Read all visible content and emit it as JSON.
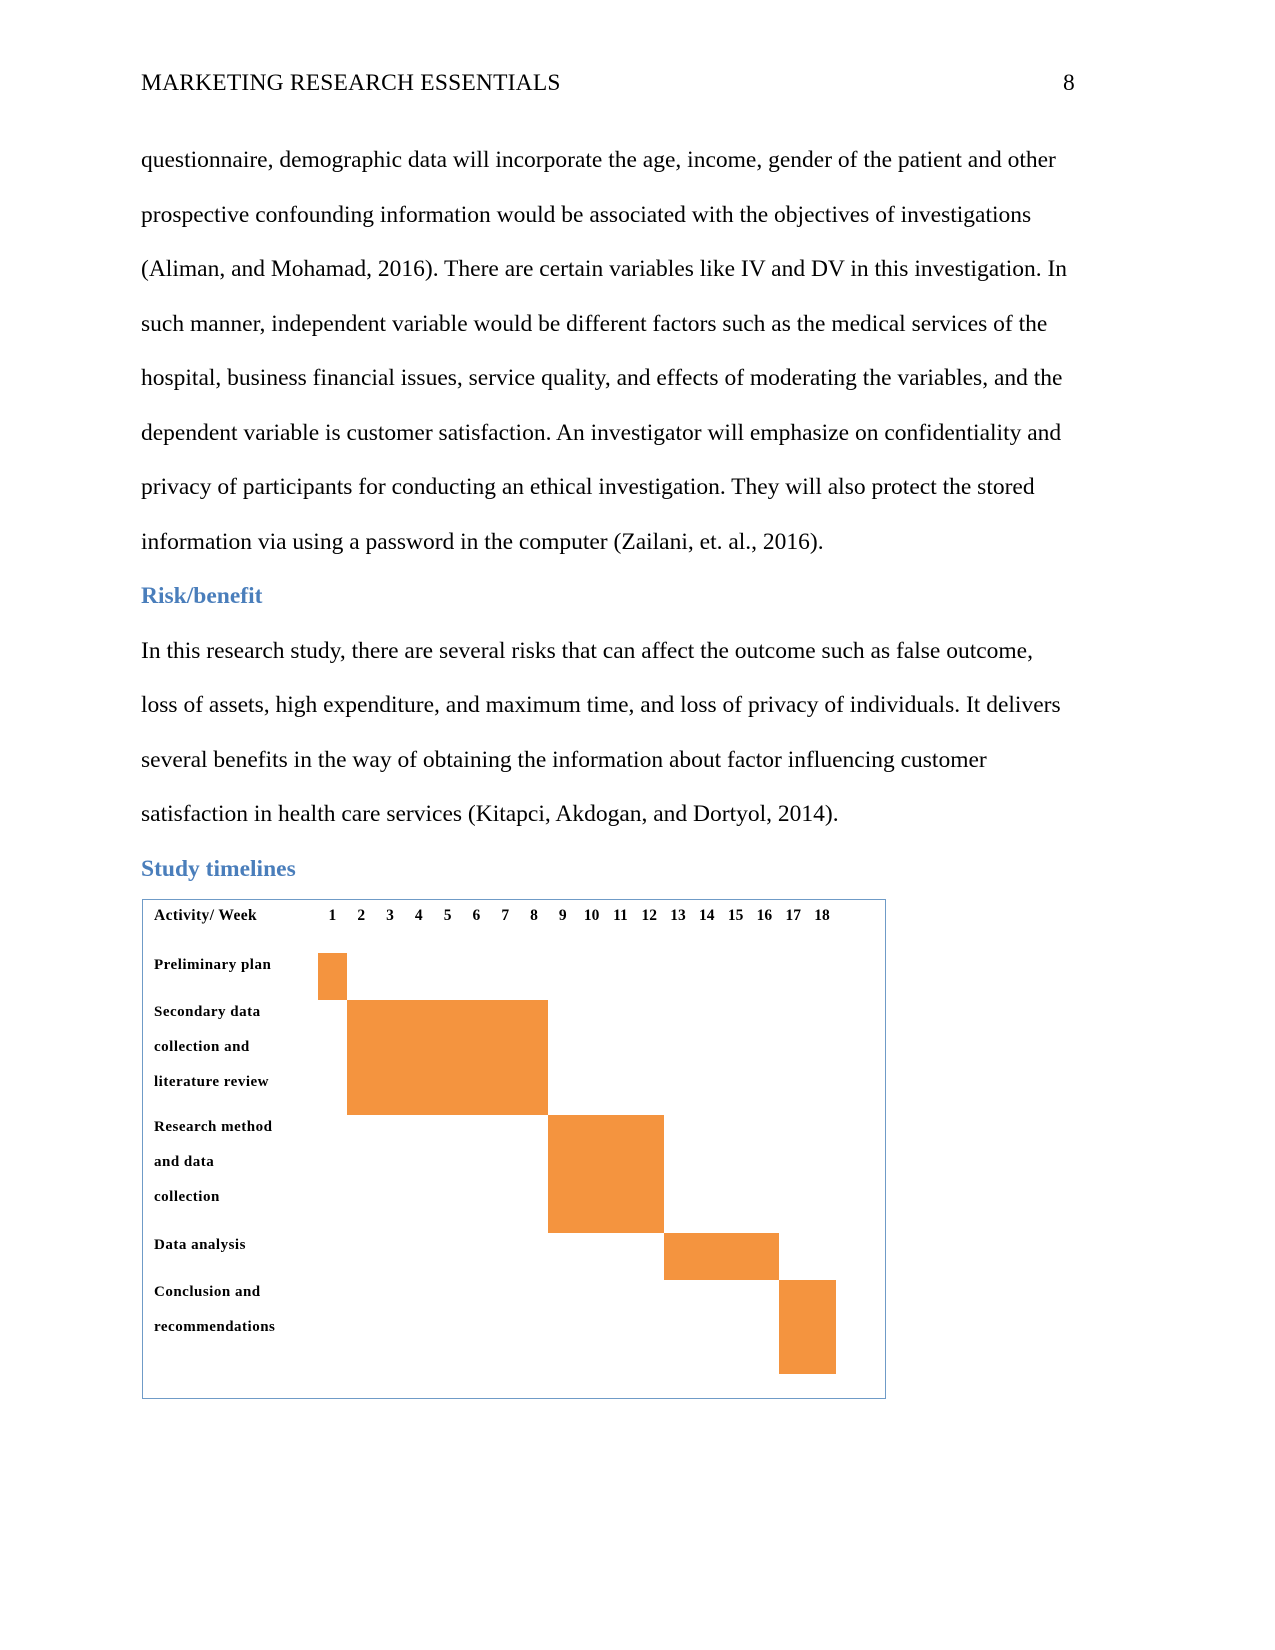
{
  "header": {
    "title": "MARKETING RESEARCH ESSENTIALS",
    "page_number": "8"
  },
  "body": {
    "paragraph_1": "questionnaire, demographic data will incorporate the age, income, gender of the patient and other prospective confounding information would be associated with the objectives of investigations (Aliman, and Mohamad, 2016). There are certain variables like IV and DV in this investigation. In such manner, independent variable would be different factors such as the medical services of the hospital, business financial issues, service quality, and effects of moderating the variables, and the dependent variable is customer satisfaction. An investigator will emphasize on confidentiality and privacy of participants for conducting an ethical investigation. They will also protect the stored information via using a password in the computer (Zailani, et. al., 2016).",
    "heading_risk_benefit": "Risk/benefit",
    "paragraph_2": "In this research study, there are several risks that can affect the outcome such as false outcome, loss of assets, high expenditure, and maximum time, and loss of privacy of individuals. It delivers several benefits in the way of obtaining the information about factor influencing customer satisfaction in health care services (Kitapci, Akdogan, and Dortyol, 2014).",
    "heading_study_timelines": "Study timelines"
  },
  "colors": {
    "heading_blue": "#4a7ebb",
    "bar_orange": "#f4943f",
    "chart_border": "#6f9bc7",
    "text_black": "#010101"
  },
  "chart_data": {
    "type": "bar",
    "title": "Study timelines",
    "axis_title": "Activity/ Week",
    "xlabel": "Week",
    "ylabel": "Activity",
    "categories": [
      "Preliminary plan",
      "Secondary data collection and literature review",
      "Research method and data collection",
      "Data analysis",
      "Conclusion and recommendations"
    ],
    "week_labels": [
      "1",
      "2",
      "3",
      "4",
      "5",
      "6",
      "7",
      "8",
      "9",
      "10",
      "11",
      "12",
      "13",
      "14",
      "15",
      "16",
      "17",
      "18"
    ],
    "xlim": [
      1,
      18
    ],
    "grid": false,
    "legend": "none",
    "series": [
      {
        "name": "Preliminary plan",
        "label_lines": [
          "Preliminary plan"
        ],
        "start_week": 1,
        "end_week": 1,
        "duration_weeks": 1
      },
      {
        "name": "Secondary data collection and literature review",
        "label_lines": [
          "Secondary data",
          "collection and",
          "literature review"
        ],
        "start_week": 2,
        "end_week": 8,
        "duration_weeks": 7
      },
      {
        "name": "Research method and data collection",
        "label_lines": [
          "Research method",
          "and data",
          "collection"
        ],
        "start_week": 9,
        "end_week": 12,
        "duration_weeks": 4
      },
      {
        "name": "Data analysis",
        "label_lines": [
          "Data analysis"
        ],
        "start_week": 13,
        "end_week": 16,
        "duration_weeks": 4
      },
      {
        "name": "Conclusion and recommendations",
        "label_lines": [
          "Conclusion and",
          "recommendations"
        ],
        "start_week": 17,
        "end_week": 18,
        "duration_weeks": 2
      }
    ]
  }
}
